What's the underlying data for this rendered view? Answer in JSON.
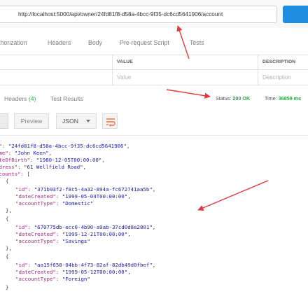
{
  "request": {
    "url": "http://localhost:5000/api/owner/24fd81f8-d58a-4bcc-9f35-dc6cd5641906/account",
    "tabs": [
      "thorization",
      "Headers",
      "Body",
      "Pre-request Script",
      "Tests"
    ]
  },
  "params": {
    "columns": [
      "VALUE",
      "DESCRIPTION"
    ],
    "placeholders": [
      "Value",
      "Description"
    ]
  },
  "response": {
    "tabs": [
      {
        "label": "Headers",
        "count": "(4)"
      },
      {
        "label": "Test Results"
      }
    ],
    "status_label": "Status:",
    "status_value": "200 OK",
    "time_label": "Time:",
    "time_value": "36859 ms"
  },
  "view": {
    "preview_label": "Preview",
    "format": "JSON"
  },
  "json_lines": [
    {
      "k": "d\":",
      "v": "\"24fd81f8-d58a-4bcc-9f35-dc6cd5641906\"",
      "e": ","
    },
    {
      "k": "ame\":",
      "v": "\"John Keen\"",
      "e": ","
    },
    {
      "k": "ateOfBirth\":",
      "v": "\"1980-12-05T00:00:00\"",
      "e": ","
    },
    {
      "k": "ddress\":",
      "v": "\"61 Wellfield Road\"",
      "e": ","
    },
    {
      "k": "ccounts\":",
      "v": "",
      "e": " ["
    },
    {
      "k": "",
      "v": "",
      "e": "{"
    },
    {
      "k": "\"id\":",
      "v": "\"371b93f2-f8c5-4a32-894a-fc672741aa5b\"",
      "e": ","
    },
    {
      "k": "\"dateCreated\":",
      "v": "\"1999-05-04T00:00:00\"",
      "e": ","
    },
    {
      "k": "\"accountType\":",
      "v": "\"Domestic\"",
      "e": ""
    },
    {
      "k": "",
      "v": "",
      "e": "},"
    },
    {
      "k": "",
      "v": "",
      "e": "{"
    },
    {
      "k": "\"id\":",
      "v": "\"670775db-ecc0-4b90-a9ab-37cd0d8e2801\"",
      "e": ","
    },
    {
      "k": "\"dateCreated\":",
      "v": "\"1999-12-21T00:00:00\"",
      "e": ","
    },
    {
      "k": "\"accountType\":",
      "v": "\"Savings\"",
      "e": ""
    },
    {
      "k": "",
      "v": "",
      "e": "},"
    },
    {
      "k": "",
      "v": "",
      "e": "{"
    },
    {
      "k": "\"id\":",
      "v": "\"aa15f658-04bb-4f73-82af-82db49d0fbef\"",
      "e": ","
    },
    {
      "k": "\"dateCreated\":",
      "v": "\"1999-05-12T00:00:00\"",
      "e": ","
    },
    {
      "k": "\"accountType\":",
      "v": "\"Foreign\"",
      "e": ""
    },
    {
      "k": "",
      "v": "",
      "e": "}"
    }
  ],
  "colors": {
    "send": "#1f8ee0",
    "status_ok": "#2aa44a",
    "wrap_icon": "#f26b3a",
    "arrow": "#e03a3a",
    "json_key": "#a0297e",
    "json_string": "#1a1aa6"
  },
  "icons": {
    "wrap": "text-wrap-icon",
    "dropdown": "chevron-down-icon"
  }
}
